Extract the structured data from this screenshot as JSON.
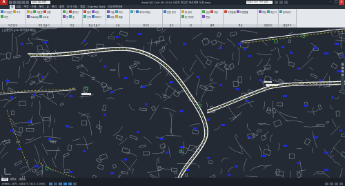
{
  "app": {
    "logo": "A",
    "title": "AutoCAD Civil 3D 2014  소방차 진입로 개선계획 도면.dwg",
    "workspace": "Civil 3D 도면",
    "search_placeholder": "키워드 또는 구문 입력"
  },
  "menu": [
    "홈",
    "삽입",
    "주석",
    "수정",
    "해석",
    "뷰",
    "관리",
    "출력",
    "추가 기능",
    "협업",
    "Express Tools",
    "지오로케이션"
  ],
  "menu_active_index": 0,
  "ribbon": {
    "panels": [
      {
        "label": "도면 탐색",
        "items": [
          "도구공간",
          "도구",
          "도면"
        ]
      },
      {
        "label": "지형 만들기",
        "items": [
          "점",
          "지표면",
          "선형",
          "프로파일",
          "교차로"
        ]
      },
      {
        "label": "작성",
        "items": [
          "선",
          "폴리선",
          "원",
          "호"
        ]
      },
      {
        "label": "형상 만들기",
        "items": [
          "절단",
          "회전",
          "신축",
          "모따기"
        ]
      },
      {
        "label": "수정",
        "items": [
          "이동",
          "복사",
          "대칭",
          "배열"
        ]
      },
      {
        "label": "레이어",
        "items": [
          "0",
          "레이어 특성"
        ]
      },
      {
        "label": "분석",
        "items": [
          "표면 분석"
        ]
      },
      {
        "label": "뷰",
        "items": [
          "뷰 정의",
          "뷰 관리자"
        ]
      },
      {
        "label": "블록",
        "items": [
          "삽입",
          "작성",
          "편집"
        ]
      },
      {
        "label": "특성",
        "items": [
          "도면층별",
          "도면층별"
        ]
      },
      {
        "label": "유틸리티",
        "items": [
          "측정",
          "계산기"
        ]
      },
      {
        "label": "클립보드",
        "items": [
          "붙여넣기"
        ]
      }
    ]
  },
  "viewport": {
    "label": "[-][평면도][2D 와이어프레임]"
  },
  "status": {
    "tabs": [
      "모형",
      "배치1",
      "배치2"
    ],
    "active_tab_index": 0,
    "coords": "198651.2873, 448275.7410, 0.0000"
  },
  "colors": {
    "background": "#232a34",
    "road": "#ffffff",
    "centerline_yellow": "#e8e03a",
    "labels_blue": "#1f2bd6",
    "markers_green": "#2fbf4a"
  }
}
